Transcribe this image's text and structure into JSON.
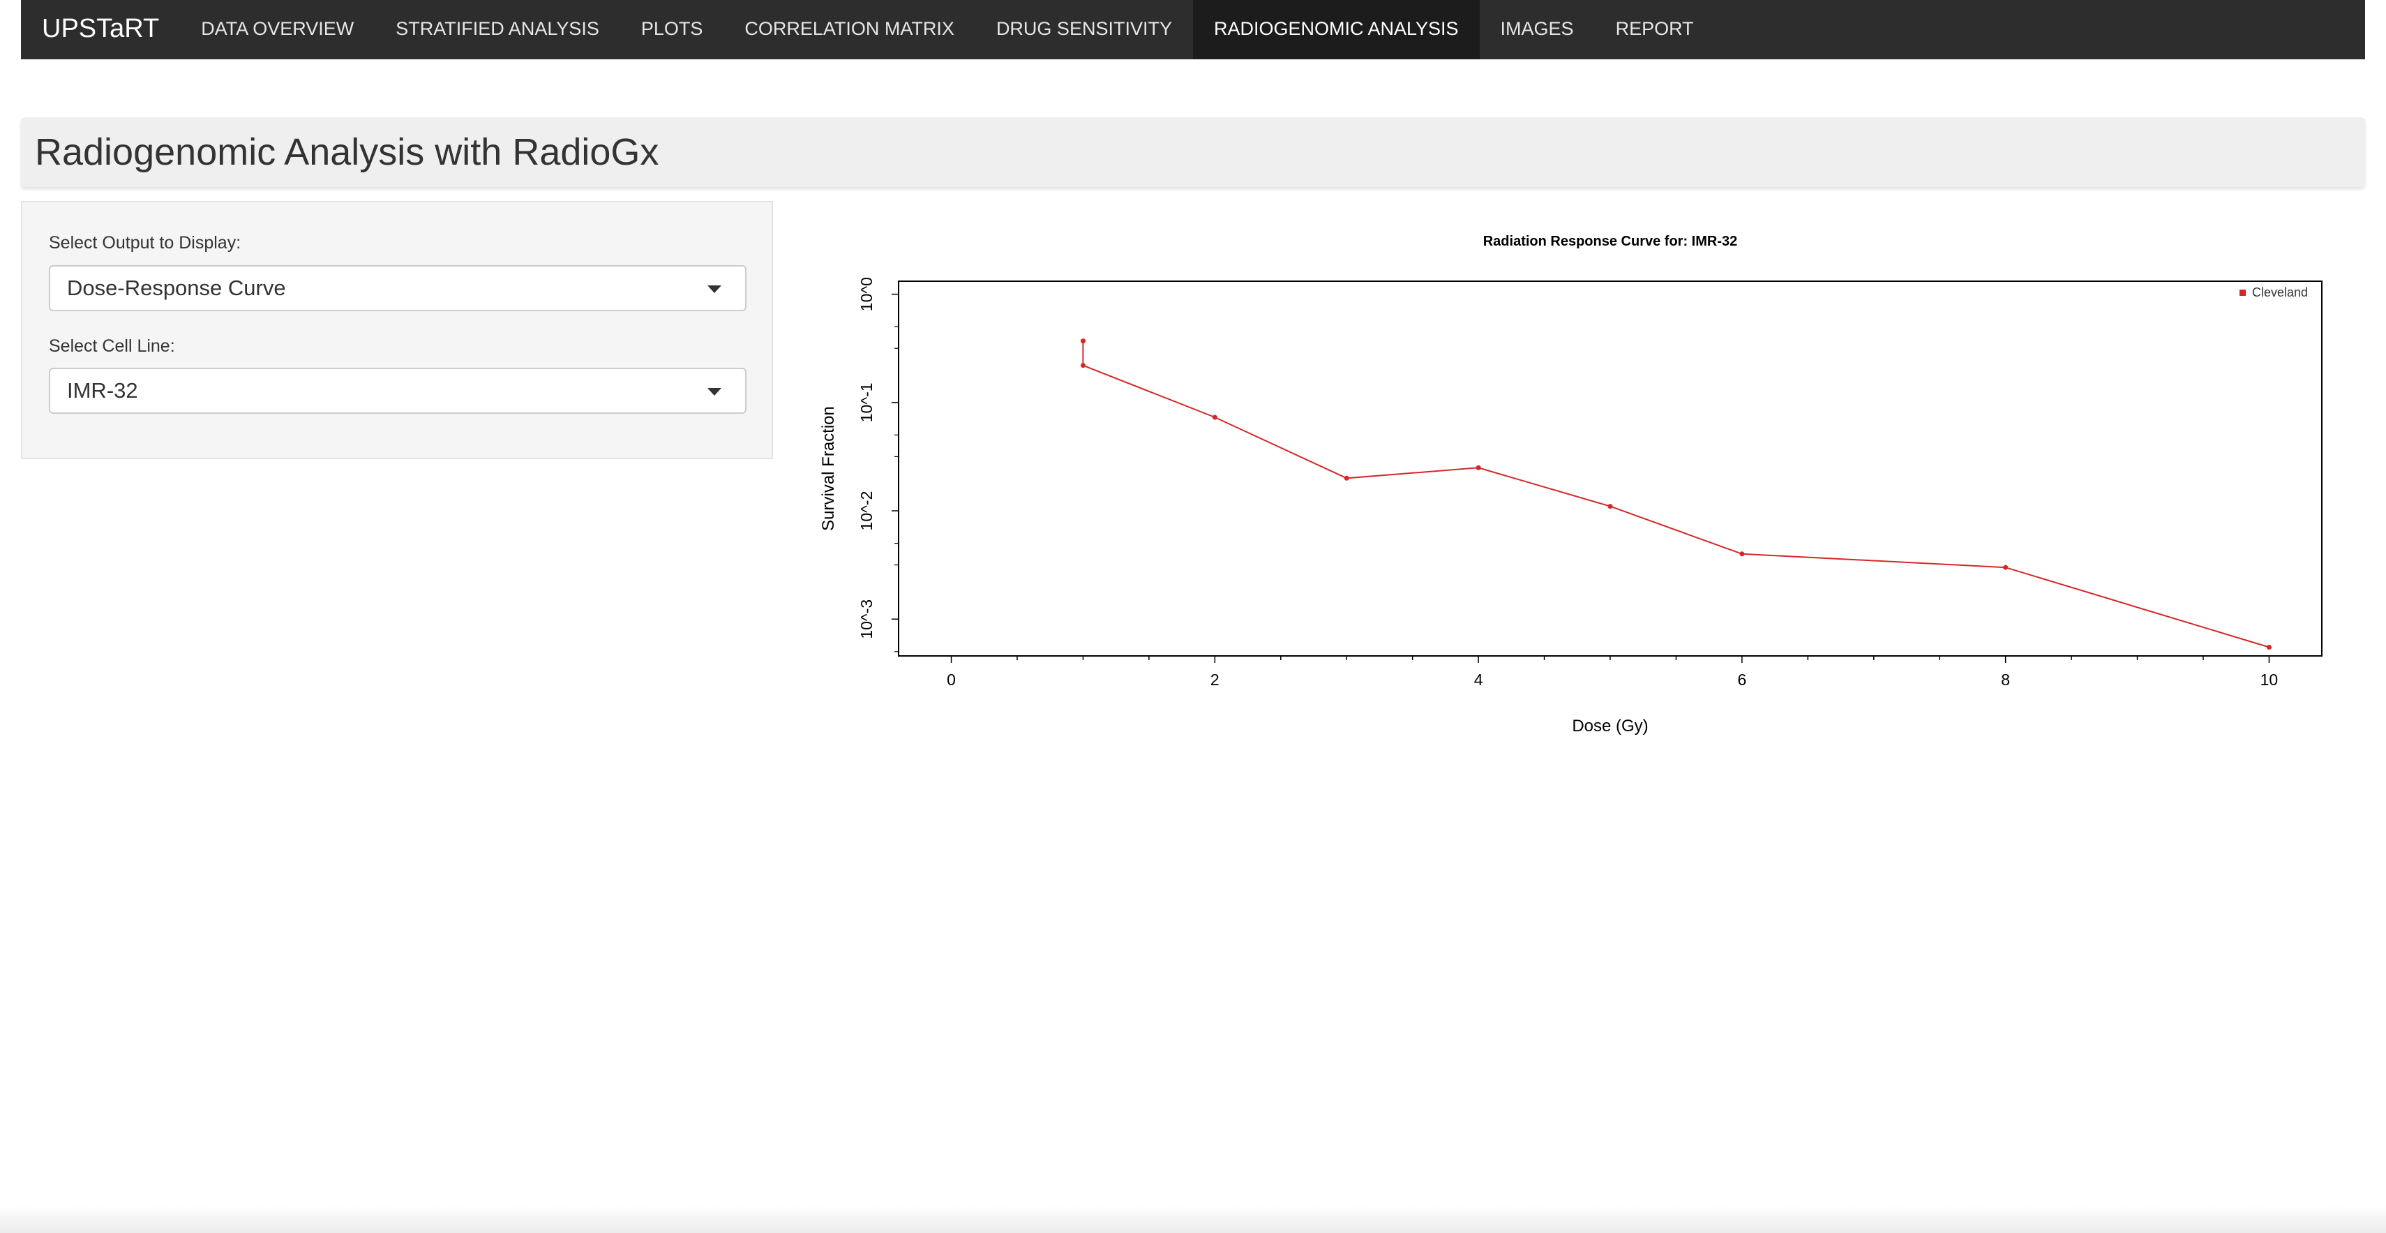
{
  "navbar": {
    "brand": "UPSTaRT",
    "tabs": [
      {
        "label": "DATA OVERVIEW"
      },
      {
        "label": "STRATIFIED ANALYSIS"
      },
      {
        "label": "PLOTS"
      },
      {
        "label": "CORRELATION MATRIX"
      },
      {
        "label": "DRUG SENSITIVITY"
      },
      {
        "label": "RADIOGENOMIC ANALYSIS",
        "active": true
      },
      {
        "label": "IMAGES"
      },
      {
        "label": "REPORT"
      }
    ]
  },
  "page": {
    "title": "Radiogenomic Analysis with RadioGx"
  },
  "sidebar": {
    "output_label": "Select Output to Display:",
    "output_value": "Dose-Response Curve",
    "cell_line_label": "Select Cell Line:",
    "cell_line_value": "IMR-32"
  },
  "colors": {
    "navbar_bg": "#2d2d2d",
    "series": "#d62728"
  },
  "chart_data": {
    "type": "line",
    "title": "Radiation Response Curve for: IMR-32",
    "xlabel": "Dose (Gy)",
    "ylabel": "Survival Fraction",
    "y_scale": "log10",
    "xlim": [
      -0.4,
      10.4
    ],
    "ylim_log10": [
      -3.34,
      0.12
    ],
    "x_ticks": [
      0,
      2,
      4,
      6,
      8,
      10
    ],
    "y_ticks": [
      {
        "exp": 0,
        "label": "10^0"
      },
      {
        "exp": -1,
        "label": "10^-1"
      },
      {
        "exp": -2,
        "label": "10^-2"
      },
      {
        "exp": -3,
        "label": "10^-3"
      }
    ],
    "legend": {
      "position": "top-right"
    },
    "series": [
      {
        "name": "Cleveland",
        "color": "#d62728",
        "x": [
          1,
          1,
          2,
          3,
          4,
          5,
          6,
          8,
          10
        ],
        "y": [
          0.37,
          0.22,
          0.073,
          0.02,
          0.025,
          0.011,
          0.004,
          0.003,
          0.00055
        ]
      }
    ]
  }
}
